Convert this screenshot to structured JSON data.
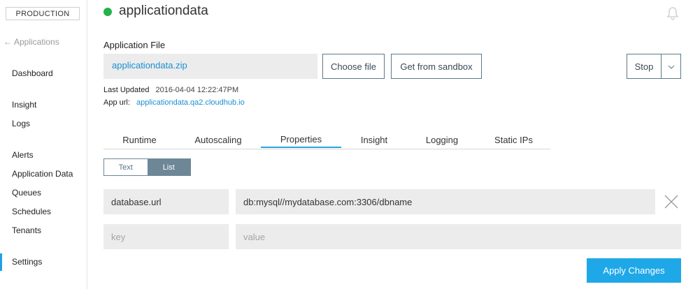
{
  "sidebar": {
    "environment": "PRODUCTION",
    "back_label": "Applications",
    "items": [
      {
        "label": "Dashboard"
      },
      {
        "label": "Insight"
      },
      {
        "label": "Logs"
      },
      {
        "label": "Alerts"
      },
      {
        "label": "Application Data"
      },
      {
        "label": "Queues"
      },
      {
        "label": "Schedules"
      },
      {
        "label": "Tenants"
      },
      {
        "label": "Settings",
        "active": true
      }
    ]
  },
  "header": {
    "app_name": "applicationdata",
    "status": "running",
    "status_color": "#25b14c",
    "notification_icon": "bell-icon"
  },
  "application_file": {
    "label": "Application File",
    "file_name": "applicationdata.zip",
    "choose_button": "Choose file",
    "sandbox_button": "Get from sandbox"
  },
  "controls": {
    "stop_button": "Stop",
    "stop_dropdown_icon": "chevron-down-icon"
  },
  "meta": {
    "last_updated_label": "Last Updated",
    "last_updated_value": "2016-04-04 12:22:47PM",
    "app_url_label": "App url:",
    "app_url_value": "applicationdata.qa2.cloudhub.io"
  },
  "tabs": [
    {
      "label": "Runtime"
    },
    {
      "label": "Autoscaling"
    },
    {
      "label": "Properties",
      "active": true
    },
    {
      "label": "Insight"
    },
    {
      "label": "Logging"
    },
    {
      "label": "Static IPs"
    }
  ],
  "view_toggle": {
    "text_label": "Text",
    "list_label": "List",
    "selected": "List"
  },
  "properties": [
    {
      "key": "database.url",
      "value": "db:mysql//mydatabase.com:3306/dbname"
    }
  ],
  "new_property": {
    "key_placeholder": "key",
    "value_placeholder": "value"
  },
  "apply_button": "Apply Changes",
  "colors": {
    "accent": "#1fa8e8",
    "link": "#1a8fd3",
    "toggle_active": "#6d8796"
  }
}
